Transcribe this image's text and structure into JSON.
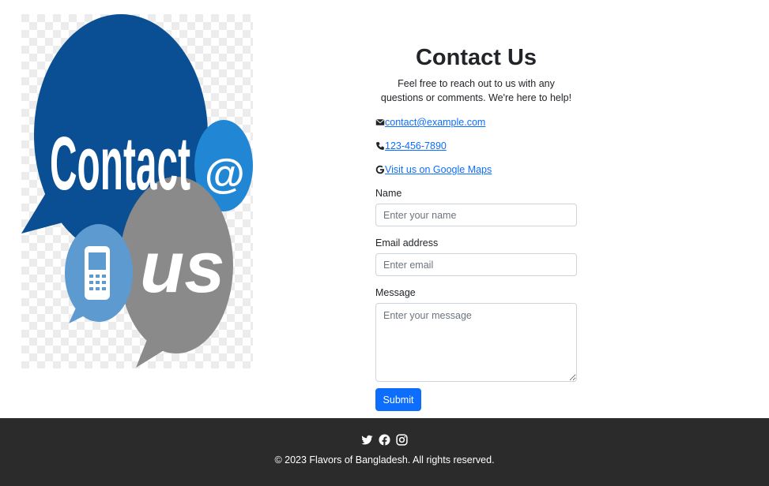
{
  "image": {
    "logo_text_main": "Contact",
    "logo_text_at": "@",
    "logo_text_us": "us"
  },
  "contact": {
    "title": "Contact Us",
    "intro": "Feel free to reach out to us with any questions or comments. We're here to help!",
    "email": "contact@example.com",
    "phone": "123-456-7890",
    "maps": "Visit us on Google Maps",
    "icons": {
      "email": "envelope-icon",
      "phone": "phone-icon",
      "maps": "google-icon"
    }
  },
  "form": {
    "name_label": "Name",
    "name_placeholder": "Enter your name",
    "email_label": "Email address",
    "email_placeholder": "Enter email",
    "message_label": "Message",
    "message_placeholder": "Enter your message",
    "submit_label": "Submit"
  },
  "footer": {
    "social_icons": [
      "twitter-icon",
      "facebook-icon",
      "instagram-icon"
    ],
    "copyright": "© 2023 Flavors of Bangladesh. All rights reserved."
  },
  "colors": {
    "accent": "#0d6efd",
    "footer_bg": "#2b2b2b",
    "bubble_dark_blue": "#0a4f93",
    "bubble_light_blue": "#2187d4",
    "bubble_grey": "#8a8a8a"
  }
}
